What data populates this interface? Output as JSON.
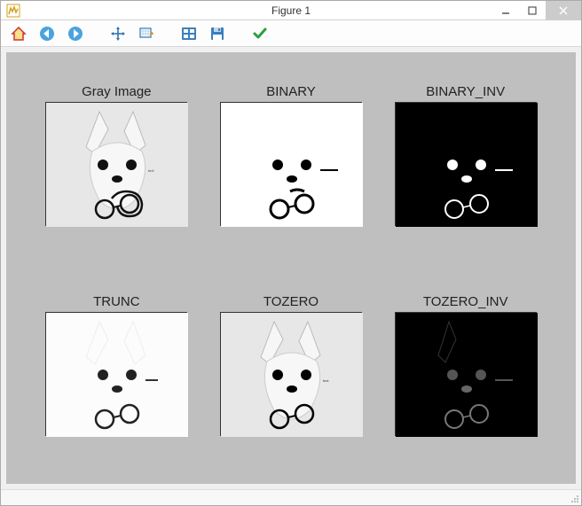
{
  "window": {
    "title": "Figure 1"
  },
  "toolbar": {
    "home": "home-icon",
    "back": "back-icon",
    "forward": "forward-icon",
    "pan": "pan-icon",
    "zoom": "zoom-icon",
    "subplots": "subplots-icon",
    "save": "save-icon",
    "check": "check-icon"
  },
  "chart_data": {
    "type": "table",
    "title": "",
    "xlabel": "",
    "ylabel": "",
    "grid": {
      "rows": 2,
      "cols": 3
    },
    "subplots": [
      {
        "row": 0,
        "col": 0,
        "title": "Gray Image",
        "kind": "grayscale",
        "description": "original grayscale photo of a small white dog holding eyeglasses"
      },
      {
        "row": 0,
        "col": 1,
        "title": "BINARY",
        "kind": "binary",
        "description": "threshold BINARY — background white, dark features black"
      },
      {
        "row": 0,
        "col": 2,
        "title": "BINARY_INV",
        "kind": "binary_inv",
        "description": "threshold BINARY_INV — background black, bright features white"
      },
      {
        "row": 1,
        "col": 0,
        "title": "TRUNC",
        "kind": "trunc",
        "description": "threshold TRUNC — bright areas clipped to light gray, dark areas kept"
      },
      {
        "row": 1,
        "col": 1,
        "title": "TOZERO",
        "kind": "tozero",
        "description": "threshold TOZERO — bright areas kept as grayscale, dark areas black on white bg appearance similar to original"
      },
      {
        "row": 1,
        "col": 2,
        "title": "TOZERO_INV",
        "kind": "tozero_inv",
        "description": "threshold TOZERO_INV — dark areas kept grayscale, bright areas set to black"
      }
    ]
  }
}
